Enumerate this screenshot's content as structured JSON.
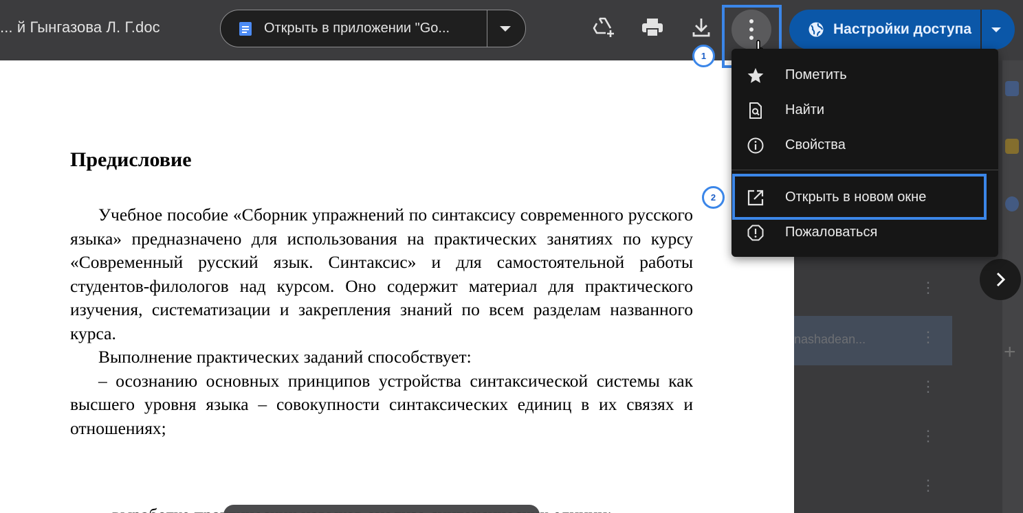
{
  "app": {
    "doc_title": "... й Гынгазова Л. Г.doc",
    "open_with_label": "Открыть в приложении \"Go...",
    "share_label": "Настройки доступа"
  },
  "toolbar": {
    "icons": [
      "add-to-drive-icon",
      "print-icon",
      "download-icon",
      "more-vert-icon"
    ]
  },
  "menu": {
    "items": [
      {
        "label": "Пометить",
        "icon": "star-icon"
      },
      {
        "label": "Найти",
        "icon": "find-icon"
      },
      {
        "label": "Свойства",
        "icon": "info-icon"
      },
      {
        "label": "Открыть в новом окне",
        "icon": "open-in-new-icon"
      },
      {
        "label": "Пожаловаться",
        "icon": "report-icon"
      }
    ]
  },
  "steps": [
    "1",
    "2"
  ],
  "document": {
    "heading": "Предисловие",
    "paragraphs": [
      "Учебное пособие «Сборник упражнений по синтаксису современного русского языка» предназначено для использования на практических занятиях по курсу «Современный русский язык. Синтаксис» и для самостоятельной работы студентов-филологов над курсом. Оно содержит материал для практического изучения, систематизации и закрепления знаний по всем разделам названного курса.",
      "Выполнение практических заданий способствует:",
      "– осознанию основных принципов устройства синтаксической системы как высшего уровня языка – совокупности синтаксических единиц в их связях и отношениях;"
    ],
    "cut_line": "– выработке практических навыков анализа синтаксических единиц;"
  },
  "background": {
    "row_text": "nashadean..."
  },
  "colors": {
    "accent": "#3b86e8",
    "share_button": "#0b57a8",
    "toolbar": "#3c3c3e",
    "menu": "#161616"
  }
}
